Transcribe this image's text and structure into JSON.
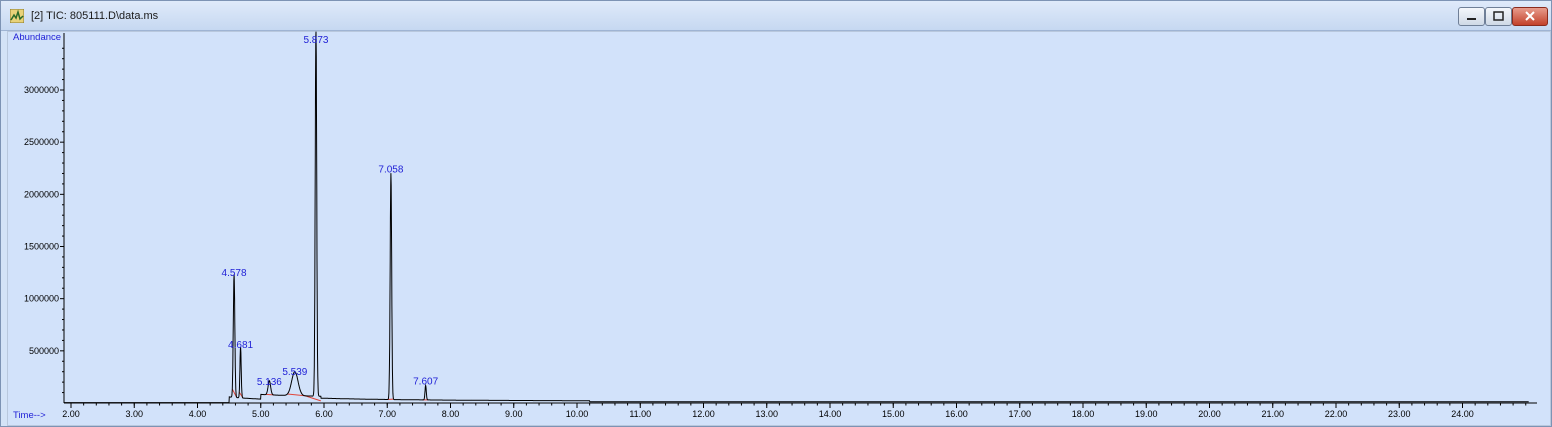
{
  "window": {
    "title": "[2] TIC: 805111.D\\data.ms",
    "icon": "chromatogram-app-icon",
    "buttons": {
      "minimize": "minimize-icon",
      "maximize": "maximize-icon",
      "close": "close-icon"
    }
  },
  "colors": {
    "signal": "#000000",
    "peak_label": "#1f1fd6",
    "baseline": "#e0453a",
    "axis_label": "#1f1fd6",
    "plot_bg": "#d2e2fa"
  },
  "chart_data": {
    "type": "line",
    "ylabel": "Abundance",
    "xlabel": "Time-->",
    "xlim": [
      1.8,
      25.1
    ],
    "ylim": [
      0,
      3500000
    ],
    "x_ticks": [
      "2.00",
      "3.00",
      "4.00",
      "5.00",
      "6.00",
      "7.00",
      "8.00",
      "9.00",
      "10.00",
      "11.00",
      "12.00",
      "13.00",
      "14.00",
      "15.00",
      "16.00",
      "17.00",
      "18.00",
      "19.00",
      "20.00",
      "21.00",
      "22.00",
      "23.00",
      "24.00"
    ],
    "y_ticks": [
      {
        "value": 500000,
        "label": "500000"
      },
      {
        "value": 1000000,
        "label": "1000000"
      },
      {
        "value": 1500000,
        "label": "1500000"
      },
      {
        "value": 2000000,
        "label": "2000000"
      },
      {
        "value": 2500000,
        "label": "2500000"
      },
      {
        "value": 3000000,
        "label": "3000000"
      }
    ],
    "peaks": [
      {
        "rt": 4.578,
        "label": "4.578",
        "height": 1180000
      },
      {
        "rt": 4.681,
        "label": "4.681",
        "height": 490000
      },
      {
        "rt": 5.136,
        "label": "5.136",
        "height": 135000
      },
      {
        "rt": 5.539,
        "label": "5.539",
        "height": 230000
      },
      {
        "rt": 5.873,
        "label": "5.873",
        "height": 3550000
      },
      {
        "rt": 7.058,
        "label": "7.058",
        "height": 2170000
      },
      {
        "rt": 7.607,
        "label": "7.607",
        "height": 140000
      }
    ],
    "grid": false,
    "legend": "none"
  }
}
